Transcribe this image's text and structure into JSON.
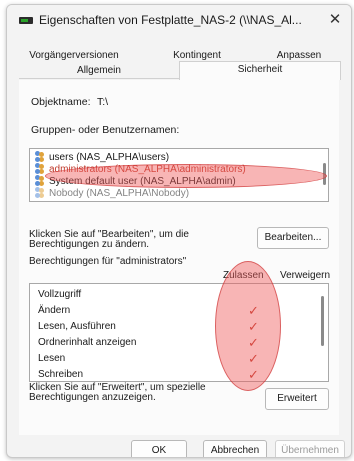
{
  "window": {
    "title": "Eigenschaften von Festplatte_NAS-2 (\\\\NAS_Al...",
    "close_glyph": "✕"
  },
  "tabs_row1": [
    {
      "label": "Vorgängerversionen"
    },
    {
      "label": "Kontingent"
    },
    {
      "label": "Anpassen"
    }
  ],
  "tabs_row2": [
    {
      "label": "Allgemein"
    },
    {
      "label": "Sicherheit",
      "active": true
    }
  ],
  "security": {
    "object_label": "Objektname:",
    "object_value": "T:\\",
    "groups_label": "Gruppen- oder Benutzernamen:",
    "users": [
      {
        "name": "users (NAS_ALPHA\\users)"
      },
      {
        "name": "administrators (NAS_ALPHA\\administrators)",
        "selected": true
      },
      {
        "name": "System default user (NAS_ALPHA\\admin)"
      },
      {
        "name": "Nobody (NAS_ALPHA\\Nobody)"
      }
    ],
    "edit_hint": "Klicken Sie auf \"Bearbeiten\", um die Berechtigungen zu ändern.",
    "edit_button": "Bearbeiten...",
    "permissions_for": "Berechtigungen für \"administrators\"",
    "col_allow": "Zulassen",
    "col_deny": "Verweigern",
    "permissions": [
      {
        "name": "Vollzugriff",
        "allow": false
      },
      {
        "name": "Ändern",
        "allow": true
      },
      {
        "name": "Lesen, Ausführen",
        "allow": true
      },
      {
        "name": "Ordnerinhalt anzeigen",
        "allow": true
      },
      {
        "name": "Lesen",
        "allow": true
      },
      {
        "name": "Schreiben",
        "allow": true
      }
    ],
    "check_glyph": "✓",
    "advanced_hint": "Klicken Sie auf \"Erweitert\", um spezielle Berechtigungen anzuzeigen.",
    "advanced_button": "Erweitert"
  },
  "footer": {
    "ok": "OK",
    "cancel": "Abbrechen",
    "apply": "Übernehmen",
    "apply_enabled": false
  },
  "colors": {
    "annotation": "#f05a5a",
    "check": "#c0392b"
  }
}
